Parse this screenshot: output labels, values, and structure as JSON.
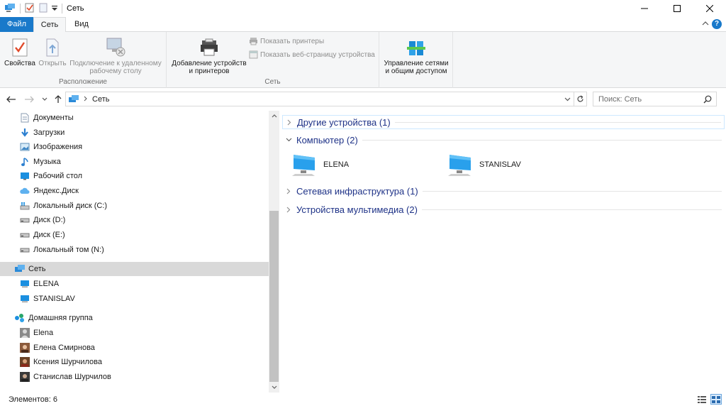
{
  "window": {
    "title": "Сеть",
    "controls": {
      "minimize": "—",
      "maximize": "☐",
      "close": "✕"
    }
  },
  "ribbon": {
    "tabs": [
      {
        "label": "Файл"
      },
      {
        "label": "Сеть"
      },
      {
        "label": "Вид"
      }
    ],
    "groups": {
      "location": {
        "label": "Расположение",
        "properties": "Свойства",
        "open": "Открыть",
        "remote_desktop_line1": "Подключение к удаленному",
        "remote_desktop_line2": "рабочему столу"
      },
      "network": {
        "label": "Сеть",
        "add_devices_line1": "Добавление устройств",
        "add_devices_line2": "и принтеров",
        "show_printers": "Показать принтеры",
        "show_device_page": "Показать веб-страницу устройства"
      },
      "sharing": {
        "line1": "Управление сетями",
        "line2": "и общим доступом"
      }
    }
  },
  "address": {
    "path": "Сеть",
    "search_placeholder": "Поиск: Сеть"
  },
  "nav": {
    "items": [
      {
        "label": "Документы",
        "icon": "documents-icon"
      },
      {
        "label": "Загрузки",
        "icon": "downloads-icon"
      },
      {
        "label": "Изображения",
        "icon": "pictures-icon"
      },
      {
        "label": "Музыка",
        "icon": "music-icon"
      },
      {
        "label": "Рабочий стол",
        "icon": "desktop-icon"
      },
      {
        "label": "Яндекс.Диск",
        "icon": "cloud-icon"
      },
      {
        "label": "Локальный диск (C:)",
        "icon": "system-drive-icon"
      },
      {
        "label": "Диск (D:)",
        "icon": "drive-icon"
      },
      {
        "label": "Диск (E:)",
        "icon": "drive-icon"
      },
      {
        "label": "Локальный том (N:)",
        "icon": "drive-icon"
      },
      {
        "label": "Сеть",
        "icon": "network-icon"
      },
      {
        "label": "ELENA",
        "icon": "computer-icon"
      },
      {
        "label": "STANISLAV",
        "icon": "computer-icon"
      },
      {
        "label": "Домашняя группа",
        "icon": "homegroup-icon"
      },
      {
        "label": "Elena",
        "icon": "user-icon"
      },
      {
        "label": "Елена Смирнова",
        "icon": "user-photo-icon"
      },
      {
        "label": "Ксения Шурчилова",
        "icon": "user-photo-icon"
      },
      {
        "label": "Станислав Шурчилов",
        "icon": "user-photo-icon"
      }
    ]
  },
  "content": {
    "groups": [
      {
        "label": "Другие устройства (1)",
        "expanded": false
      },
      {
        "label": "Компьютер (2)",
        "expanded": true
      },
      {
        "label": "Сетевая инфраструктура (1)",
        "expanded": false
      },
      {
        "label": "Устройства мультимедиа (2)",
        "expanded": false
      }
    ],
    "computers": [
      {
        "name": "ELENA"
      },
      {
        "name": "STANISLAV"
      }
    ]
  },
  "status": {
    "text": "Элементов: 6"
  },
  "colors": {
    "accent": "#1979ca",
    "group_header": "#1e3287",
    "selected_bg": "#d9d9d9",
    "ribbon_bg": "#f5f6f7"
  }
}
